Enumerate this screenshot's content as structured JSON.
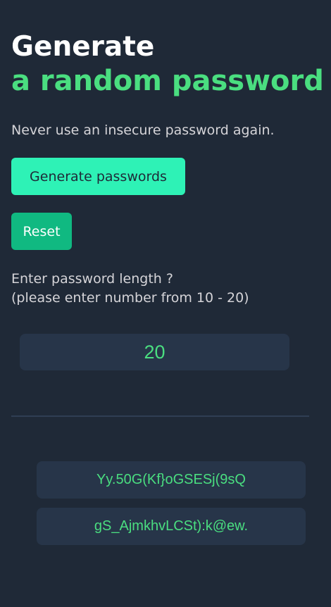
{
  "header": {
    "title_line1": "Generate",
    "title_line2": "a random password"
  },
  "subtitle": "Never use an insecure password again.",
  "buttons": {
    "generate_label": "Generate passwords",
    "reset_label": "Reset"
  },
  "length_prompt": {
    "line1": "Enter password length ?",
    "line2": "(please enter number from 10 - 20)"
  },
  "length_input": {
    "value": "20"
  },
  "passwords": [
    "Yy.50G(Kf}oGSESj(9sQ",
    "gS_AjmkhvLCSt):k@ew."
  ],
  "colors": {
    "background": "#1f2937",
    "accent_green": "#4ade80",
    "generate_button": "#2ef2b6",
    "reset_button": "#10b981",
    "field_background": "#273549"
  }
}
